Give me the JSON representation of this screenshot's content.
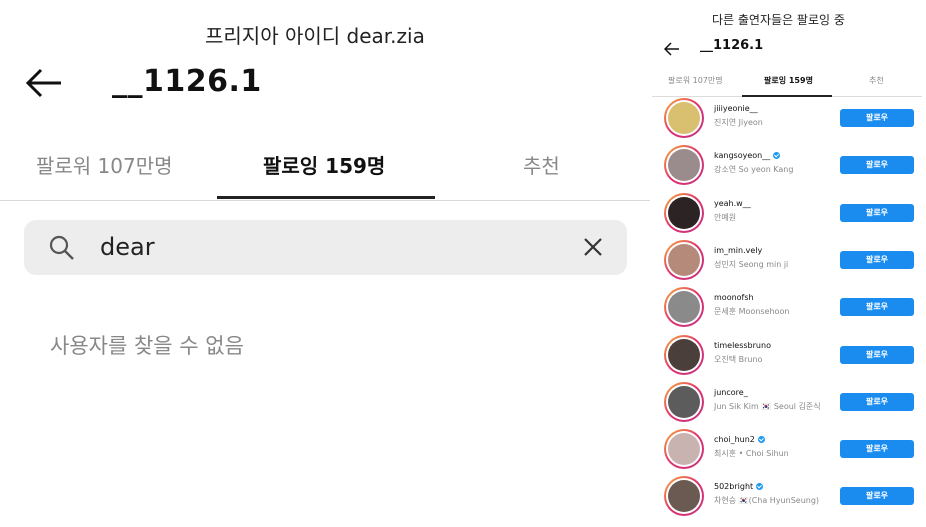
{
  "left": {
    "caption": "프리지아 아이디 dear.zia",
    "handle": "__1126.1",
    "tabs": [
      {
        "label": "팔로워 107만명",
        "active": false
      },
      {
        "label": "팔로잉 159명",
        "active": true
      },
      {
        "label": "추천",
        "active": false
      }
    ],
    "search": {
      "value": "dear"
    },
    "empty_message": "사용자를 찾을 수 없음"
  },
  "right": {
    "caption": "다른 출연자들은 팔로잉 중",
    "handle": "__1126.1",
    "tabs": [
      {
        "label": "팔로워 107만명",
        "active": false
      },
      {
        "label": "팔로잉 159명",
        "active": true
      },
      {
        "label": "추천",
        "active": false
      }
    ],
    "follow_label": "팔로우",
    "accounts": [
      {
        "username": "jiiiyeonie__",
        "name": "진지연 Jiyeon",
        "verified": false,
        "color": "#d8c070"
      },
      {
        "username": "kangsoyeon__",
        "name": "강소연 So yeon Kang",
        "verified": true,
        "color": "#9a8c8c"
      },
      {
        "username": "yeah.w__",
        "name": "안예원",
        "verified": false,
        "color": "#2c2424"
      },
      {
        "username": "im_min.vely",
        "name": "성민지 Seong min ji",
        "verified": false,
        "color": "#b58a7a"
      },
      {
        "username": "moonofsh",
        "name": "문세훈 Moonsehoon",
        "verified": false,
        "color": "#8a8a8a"
      },
      {
        "username": "timelessbruno",
        "name": "오진택 Bruno",
        "verified": false,
        "color": "#4a3f3a"
      },
      {
        "username": "juncore_",
        "name": "Jun Sik Kim 🇰🇷 Seoul 김준식",
        "verified": false,
        "color": "#5c5c5c"
      },
      {
        "username": "choi_hun2",
        "name": "최시훈 • Choi Sihun",
        "verified": true,
        "color": "#c9b3b0"
      },
      {
        "username": "502bright",
        "name": "차현승 🇰🇷(Cha HyunSeung)",
        "verified": true,
        "color": "#6b5a52"
      }
    ]
  }
}
